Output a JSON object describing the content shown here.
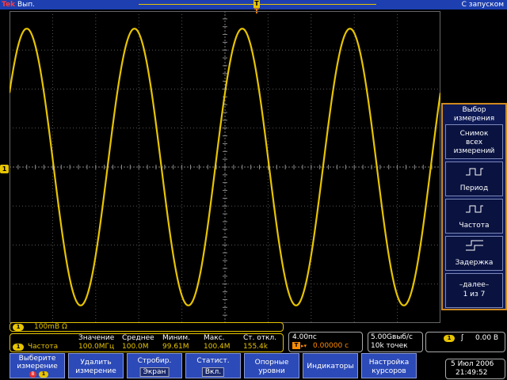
{
  "status_bar": {
    "logo": "Tek",
    "run_state": "Вып.",
    "trigger_mode": "С запуском",
    "trigger_position_marker": "T"
  },
  "channel_marker": "1",
  "side_menu": {
    "title_line1": "Выбор",
    "title_line2": "измерения",
    "items": [
      {
        "line1": "Снимок",
        "line2": "всех",
        "line3": "измерений"
      },
      {
        "label": "Период",
        "icon": "period-icon"
      },
      {
        "label": "Частота",
        "icon": "frequency-icon"
      },
      {
        "label": "Задержка",
        "icon": "delay-icon"
      },
      {
        "line1": "–далее–",
        "line2": "1 из 7"
      }
    ]
  },
  "ch1_readout": {
    "badge": "1",
    "scale": "100mB Ω"
  },
  "measurement": {
    "badge": "1",
    "name": "Частота",
    "headers": [
      "Значение",
      "Среднее",
      "Миним.",
      "Макс.",
      "Ст. откл."
    ],
    "values": [
      "100.0МГц",
      "100.0M",
      "99.61M",
      "100.4M",
      "155.4k"
    ]
  },
  "horizontal": {
    "scale": "4.00пс",
    "position": "0.00000 с",
    "trig_icon": "T"
  },
  "acquisition": {
    "rate": "5.00Gвыб/с",
    "points": "10k точек"
  },
  "trigger": {
    "badge": "1",
    "slope": "ʃ",
    "level": "0.00 B"
  },
  "bottom_menu": {
    "items": [
      {
        "line1": "Выберите",
        "line2": "измерение",
        "badge_b": "B",
        "badge_1": "1"
      },
      {
        "line1": "Удалить",
        "line2": "измерение"
      },
      {
        "line1": "Стробир.",
        "value": "Экран"
      },
      {
        "line1": "Статист.",
        "value": "Вкл."
      },
      {
        "line1": "Опорные",
        "line2": "уровни"
      },
      {
        "label": "Индикаторы"
      },
      {
        "line1": "Настройка",
        "line2": "курсоров"
      }
    ]
  },
  "datetime": {
    "date": "5 Июл 2006",
    "time": "21:49:52"
  },
  "colors": {
    "ch1": "#e7c400",
    "menu_bg": "#2c4ab8",
    "topbar": "#1d3fb0",
    "trigger_marker": "#ff8c00"
  }
}
